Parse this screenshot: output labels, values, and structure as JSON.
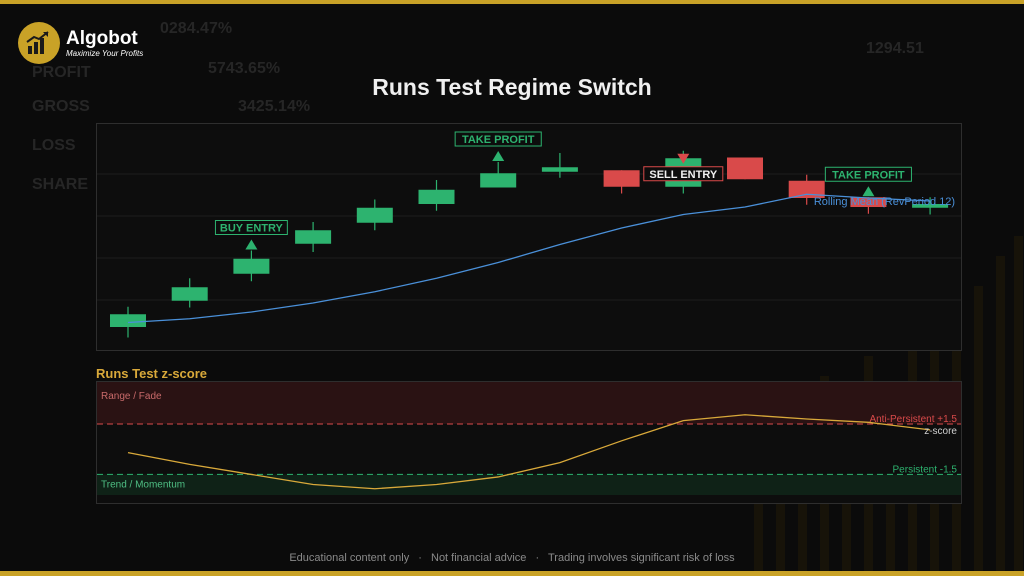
{
  "brand": {
    "name": "Algobot",
    "tagline": "Maximize Your Profits"
  },
  "title": "Runs Test Regime Switch",
  "background": {
    "labels": [
      "PROFIT",
      "GROSS",
      "LOSS",
      "SHARE"
    ],
    "values": [
      "0284.47%",
      "5743.65%",
      "3425.14%",
      "1294.51"
    ]
  },
  "colors": {
    "bull": "#2db36f",
    "bear": "#d94a4a",
    "mean_line": "#4a90d9",
    "zscore_line": "#d9a93a",
    "gold": "#c9a227"
  },
  "chart_data": [
    {
      "type": "candlestick",
      "candles": [
        {
          "open": 1.0,
          "close": 1.85,
          "high": 2.35,
          "low": 0.3
        },
        {
          "open": 2.75,
          "close": 3.65,
          "high": 4.25,
          "low": 2.3
        },
        {
          "open": 4.55,
          "close": 5.55,
          "high": 6.1,
          "low": 4.05
        },
        {
          "open": 6.55,
          "close": 7.45,
          "high": 8.0,
          "low": 6.0
        },
        {
          "open": 7.95,
          "close": 8.95,
          "high": 9.5,
          "low": 7.45
        },
        {
          "open": 9.2,
          "close": 10.15,
          "high": 10.8,
          "low": 8.75
        },
        {
          "open": 10.3,
          "close": 11.25,
          "high": 12.0,
          "low": 10.3
        },
        {
          "open": 11.35,
          "close": 11.65,
          "high": 12.6,
          "low": 10.95
        },
        {
          "open": 11.45,
          "close": 10.35,
          "high": 11.45,
          "low": 9.9
        },
        {
          "open": 10.35,
          "close": 12.25,
          "high": 12.75,
          "low": 9.9
        },
        {
          "open": 12.3,
          "close": 10.85,
          "high": 12.3,
          "low": 10.85
        },
        {
          "open": 10.75,
          "close": 9.6,
          "high": 11.15,
          "low": 9.15
        },
        {
          "open": 9.65,
          "close": 9.0,
          "high": 9.65,
          "low": 8.55
        },
        {
          "open": 8.95,
          "close": 9.2,
          "high": 9.65,
          "low": 8.5
        }
      ],
      "rolling_mean": {
        "name": "Rolling Mean (RevPeriod 12)",
        "values": [
          1.3,
          1.55,
          2.0,
          2.6,
          3.35,
          4.25,
          5.3,
          6.5,
          7.6,
          8.5,
          9.0,
          9.85,
          9.6,
          9.4
        ]
      },
      "annotations": [
        {
          "label": "BUY ENTRY",
          "index": 2,
          "kind": "buy"
        },
        {
          "label": "TAKE PROFIT",
          "index": 6,
          "kind": "buy"
        },
        {
          "label": "SELL ENTRY",
          "index": 9,
          "kind": "sell"
        },
        {
          "label": "TAKE PROFIT",
          "index": 12,
          "kind": "buy"
        }
      ],
      "ylim": [
        0,
        14
      ],
      "grid": true
    },
    {
      "type": "line",
      "title": "Runs Test z-score",
      "series": [
        {
          "name": "z-score",
          "values": [
            -0.2,
            -0.9,
            -1.5,
            -2.1,
            -2.35,
            -2.1,
            -1.65,
            -0.8,
            0.5,
            1.7,
            2.05,
            1.8,
            1.6,
            1.15
          ]
        }
      ],
      "thresholds": [
        {
          "label": "Anti-Persistent +1.5",
          "value": 1.5,
          "color": "#d94a4a"
        },
        {
          "label": "Persistent -1.5",
          "value": -1.5,
          "color": "#2db36f"
        }
      ],
      "zones": [
        {
          "label": "Range / Fade",
          "kind": "top"
        },
        {
          "label": "Trend / Momentum",
          "kind": "bottom"
        }
      ],
      "ylim": [
        -3.2,
        4.0
      ]
    }
  ],
  "footer": {
    "parts": [
      "Educational content only",
      "Not financial advice",
      "Trading involves significant risk of loss"
    ],
    "separator": "·"
  }
}
